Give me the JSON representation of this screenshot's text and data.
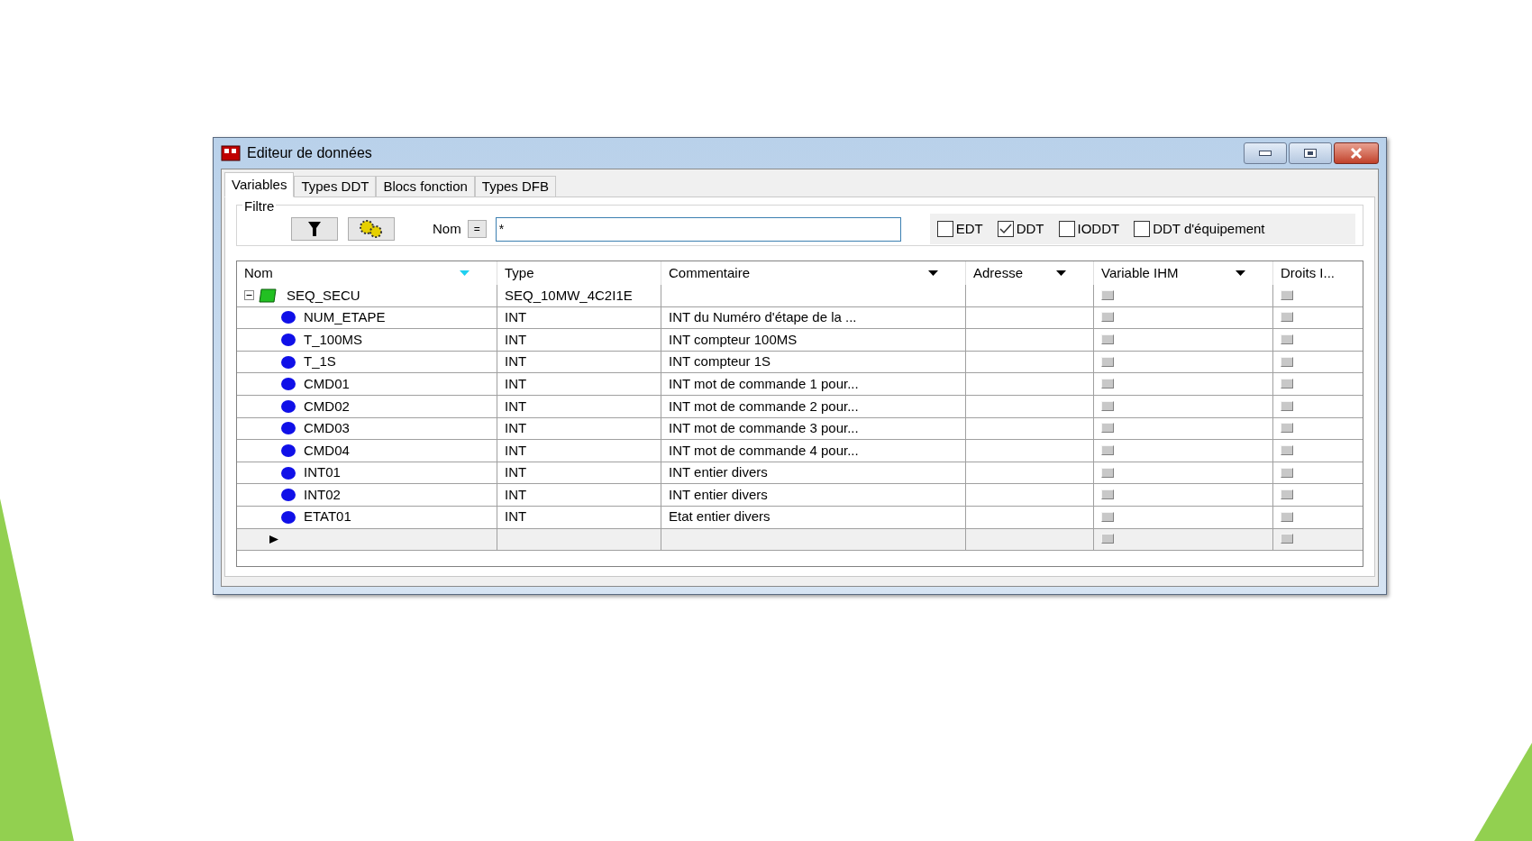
{
  "window": {
    "title": "Editeur de données"
  },
  "tabs": [
    {
      "label": "Variables",
      "selected": true
    },
    {
      "label": "Types DDT",
      "selected": false
    },
    {
      "label": "Blocs fonction",
      "selected": false
    },
    {
      "label": "Types DFB",
      "selected": false
    }
  ],
  "filter": {
    "label": "Filtre",
    "name_label": "Nom",
    "operator": "=",
    "value": "*",
    "checkboxes": [
      {
        "label": "EDT",
        "checked": false
      },
      {
        "label": "DDT",
        "checked": true
      },
      {
        "label": "IODDT",
        "checked": false
      },
      {
        "label": "DDT d'équipement",
        "checked": false
      }
    ]
  },
  "table": {
    "columns": [
      {
        "label": "Nom",
        "sorted": true,
        "menu": false
      },
      {
        "label": "Type",
        "sorted": false,
        "menu": false
      },
      {
        "label": "Commentaire",
        "sorted": false,
        "menu": true
      },
      {
        "label": "Adresse",
        "sorted": false,
        "menu": true
      },
      {
        "label": "Variable IHM",
        "sorted": false,
        "menu": true
      },
      {
        "label": "Droits I...",
        "sorted": false,
        "menu": false
      }
    ],
    "rows": [
      {
        "name": "SEQ_SECU",
        "type": "SEQ_10MW_4C2I1E",
        "expanded": true,
        "children": [
          {
            "name": "NUM_ETAPE",
            "type": "INT",
            "comment": "INT du Numéro d'étape de la ..."
          },
          {
            "name": "T_100MS",
            "type": "INT",
            "comment": "INT compteur 100MS"
          },
          {
            "name": "T_1S",
            "type": "INT",
            "comment": "INT compteur 1S"
          },
          {
            "name": "CMD01",
            "type": "INT",
            "comment": "INT mot de commande 1 pour..."
          },
          {
            "name": "CMD02",
            "type": "INT",
            "comment": "INT mot de commande 2 pour..."
          },
          {
            "name": "CMD03",
            "type": "INT",
            "comment": "INT mot de commande 3 pour..."
          },
          {
            "name": "CMD04",
            "type": "INT",
            "comment": "INT mot de commande 4 pour..."
          },
          {
            "name": "INT01",
            "type": "INT",
            "comment": "INT entier divers"
          },
          {
            "name": "INT02",
            "type": "INT",
            "comment": "INT entier divers"
          },
          {
            "name": "ETAT01",
            "type": "INT",
            "comment": "Etat entier divers"
          }
        ]
      }
    ]
  }
}
